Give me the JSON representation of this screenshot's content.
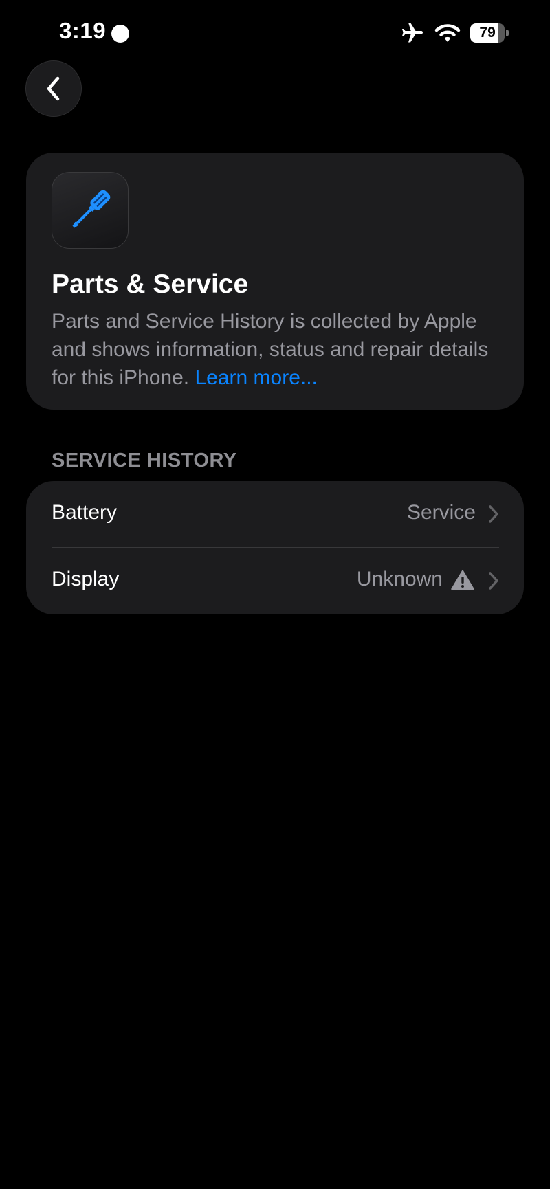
{
  "status_bar": {
    "time": "3:19",
    "battery_level": "79",
    "battery_fraction": 0.79,
    "icons": [
      "recording-dot-icon",
      "airplane-icon",
      "wifi-icon",
      "battery-icon"
    ]
  },
  "nav": {
    "back_icon": "chevron-left-icon"
  },
  "info_card": {
    "icon": "screwdriver-icon",
    "title": "Parts & Service",
    "description": "Parts and Service History is collected by Apple and shows information, status and repair details for this iPhone.",
    "learn_more": "Learn more..."
  },
  "service_history": {
    "header": "SERVICE HISTORY",
    "rows": [
      {
        "label": "Battery",
        "value": "Service",
        "icon": "chevron-right-icon"
      },
      {
        "label": "Display",
        "value": "Unknown",
        "icon": "warning-icon"
      }
    ]
  },
  "colors": {
    "background": "#000000",
    "card": "#1c1c1e",
    "accent": "#0a84ff",
    "secondary_text": "#98989f",
    "section_header": "#8e8e93"
  }
}
